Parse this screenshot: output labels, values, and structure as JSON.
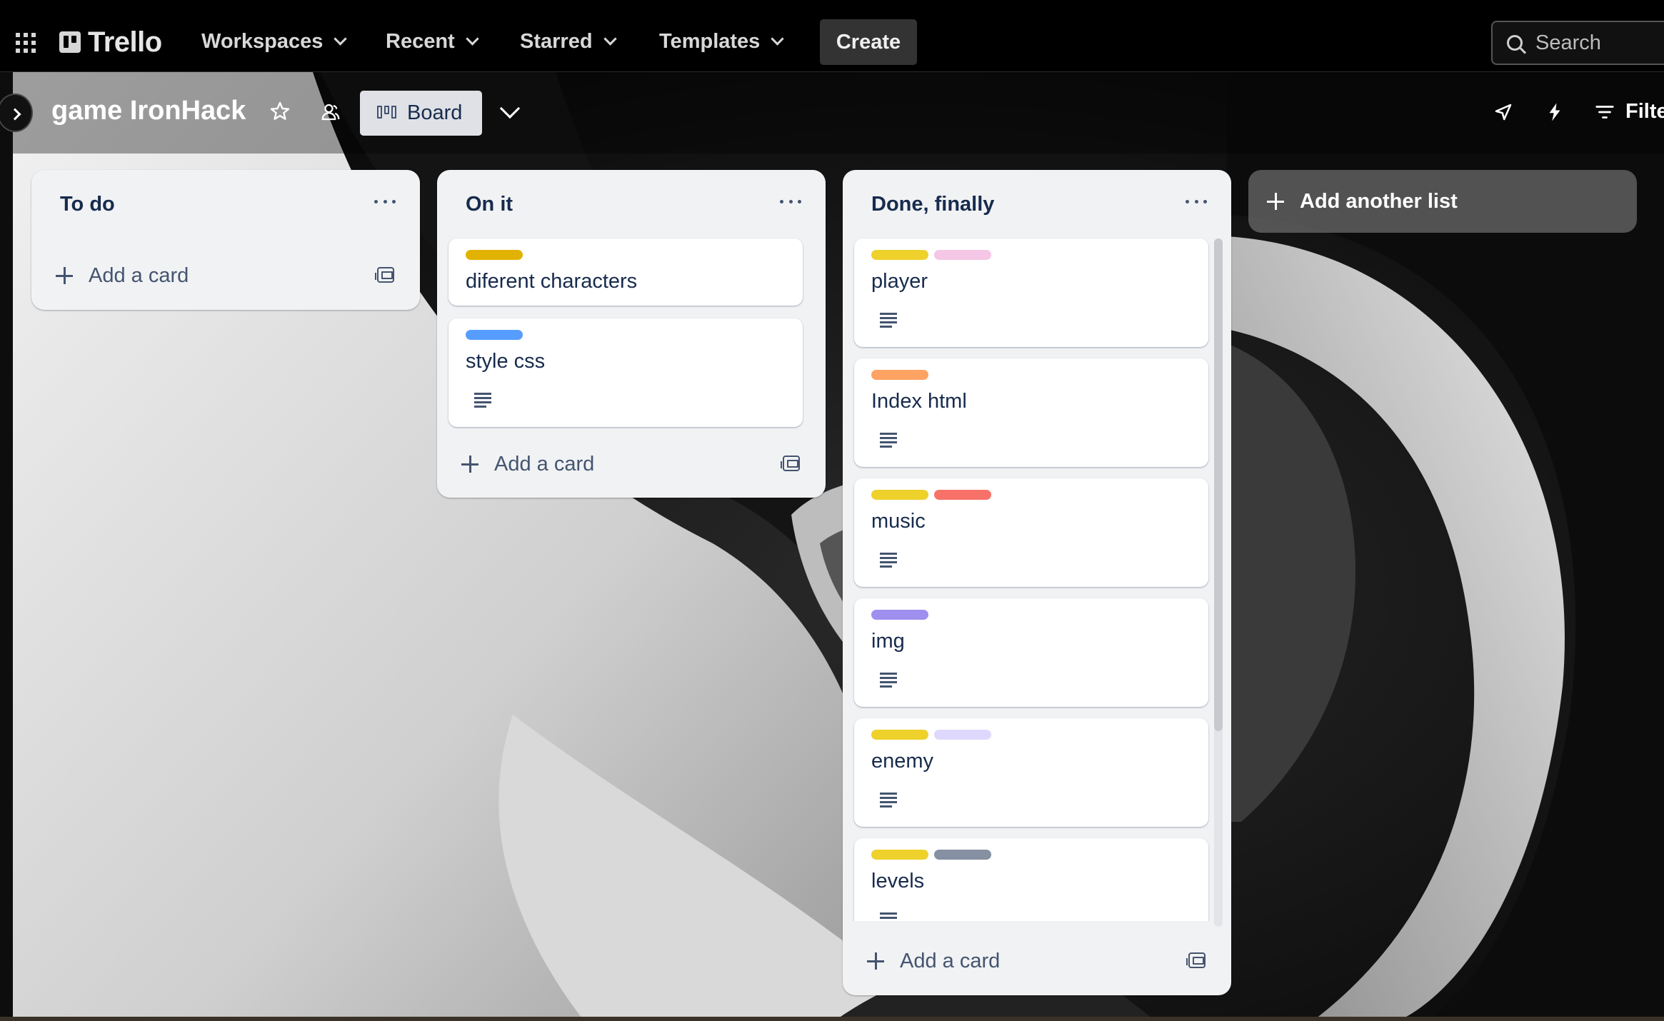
{
  "topnav": {
    "logo_text": "Trello",
    "items": [
      {
        "label": "Workspaces"
      },
      {
        "label": "Recent"
      },
      {
        "label": "Starred"
      },
      {
        "label": "Templates"
      }
    ],
    "create_label": "Create",
    "search_placeholder": "Search"
  },
  "board": {
    "title": "game IronHack",
    "view_label": "Board",
    "filter_label": "Filte"
  },
  "lists": [
    {
      "title": "To do",
      "add_card_label": "Add a card",
      "cards": []
    },
    {
      "title": "On it",
      "add_card_label": "Add a card",
      "cards": [
        {
          "title": "diferent characters",
          "labels": [
            "#e2b203"
          ],
          "has_description": false
        },
        {
          "title": "style css",
          "labels": [
            "#579dff"
          ],
          "has_description": true
        }
      ]
    },
    {
      "title": "Done, finally",
      "add_card_label": "Add a card",
      "cards": [
        {
          "title": "player",
          "labels": [
            "#eed12b",
            "#f5c6e6"
          ],
          "has_description": true
        },
        {
          "title": "Index html",
          "labels": [
            "#fea362"
          ],
          "has_description": true
        },
        {
          "title": "music",
          "labels": [
            "#eed12b",
            "#f87168"
          ],
          "has_description": true
        },
        {
          "title": "img",
          "labels": [
            "#9f8fef"
          ],
          "has_description": true
        },
        {
          "title": "enemy",
          "labels": [
            "#eed12b",
            "#dfd8fd"
          ],
          "has_description": true
        },
        {
          "title": "levels",
          "labels": [
            "#eed12b",
            "#8590a2"
          ],
          "has_description": true
        }
      ]
    }
  ],
  "add_list_label": "Add another list"
}
